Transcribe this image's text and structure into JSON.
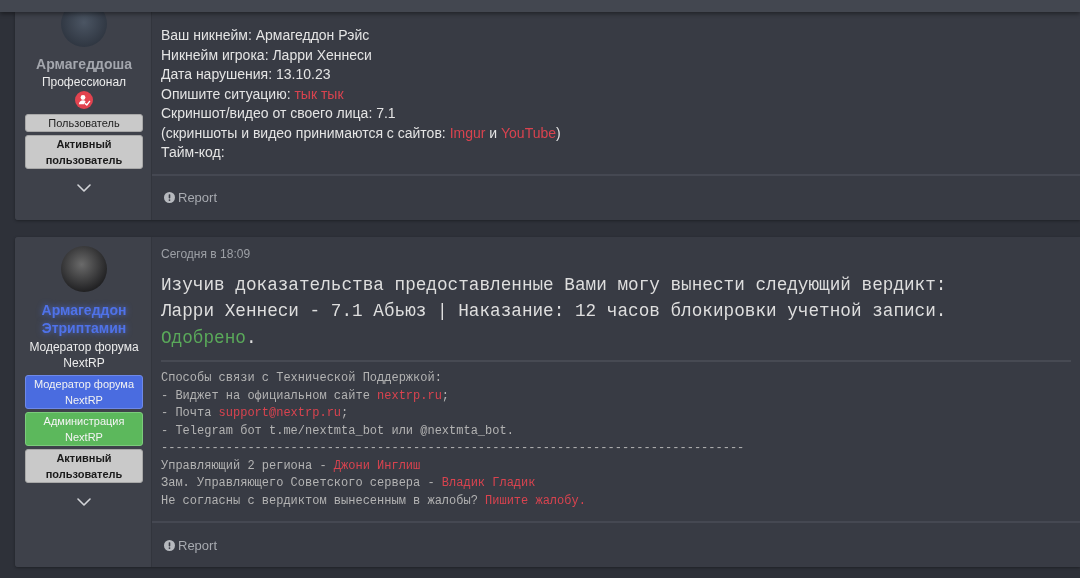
{
  "posts": [
    {
      "author": {
        "name": "Армагеддоша",
        "color": "#a3a6ad",
        "glow": false,
        "title": "Профессионал",
        "award_icon": true,
        "banners": [
          {
            "label": "Пользователь",
            "kind": "user"
          },
          {
            "label": "Активный пользователь",
            "kind": "active"
          }
        ]
      },
      "body": [
        {
          "kind": "form",
          "lines": [
            [
              {
                "text": "Ваш никнейм: Армагеддон Рэйс",
                "kind": "plain"
              }
            ],
            [
              {
                "text": "Никнейм игрока: Ларри Хеннеси",
                "kind": "plain"
              }
            ],
            [
              {
                "text": "Дата нарушения: 13.10.23",
                "kind": "plain"
              }
            ],
            [
              {
                "text": "Опишите ситуацию: ",
                "kind": "plain"
              },
              {
                "text": "тык тык",
                "kind": "link"
              }
            ],
            [
              {
                "text": "Скриншот/видео от своего лица: 7.1",
                "kind": "plain"
              }
            ],
            [
              {
                "text": "(скриншоты и видео принимаются с сайтов: ",
                "kind": "plain"
              },
              {
                "text": "Imgur",
                "kind": "link"
              },
              {
                "text": " и ",
                "kind": "plain"
              },
              {
                "text": "YouTube",
                "kind": "link"
              },
              {
                "text": ")",
                "kind": "plain"
              }
            ],
            [
              {
                "text": "Тайм-код:",
                "kind": "plain"
              }
            ]
          ]
        }
      ],
      "report": "Report"
    },
    {
      "author": {
        "name": "Армагеддон Этриптамин",
        "color": "#4f72e8",
        "glow": true,
        "title": "Модератор форума NextRP",
        "award_icon": false,
        "banners": [
          {
            "label": "Модератор форума NextRP",
            "kind": "moderator"
          },
          {
            "label": "Администрация NextRP",
            "kind": "admin"
          },
          {
            "label": "Активный пользователь",
            "kind": "active"
          }
        ]
      },
      "date": "Сегодня в 18:09",
      "body": [
        {
          "kind": "verdict",
          "lines": [
            [
              {
                "text": "Изучив доказательства предоставленные Вами могу вынести следующий вердикт:",
                "kind": "plain"
              }
            ],
            [
              {
                "text": "Ларри Хеннеси - 7.1 Абьюз | Наказание: 12 часов блокировки учетной записи.",
                "kind": "plain"
              }
            ],
            [
              {
                "text": "Одобрено",
                "kind": "success"
              },
              {
                "text": ".",
                "kind": "plain"
              }
            ]
          ]
        },
        {
          "kind": "signature",
          "lines": [
            [
              {
                "text": "Способы связи с Технической Поддержкой:",
                "kind": "plain"
              }
            ],
            [
              {
                "text": "- Виджет на официальном сайте ",
                "kind": "plain"
              },
              {
                "text": "nextrp.ru",
                "kind": "link"
              },
              {
                "text": ";",
                "kind": "plain"
              }
            ],
            [
              {
                "text": "- Почта ",
                "kind": "plain"
              },
              {
                "text": "support@nextrp.ru",
                "kind": "link"
              },
              {
                "text": ";",
                "kind": "plain"
              }
            ],
            [
              {
                "text": "- Telegram бот t.me/nextmta_bot или @nextmta_bot.",
                "kind": "plain"
              }
            ],
            [
              {
                "text": "---------------------------------------------------------------------------------",
                "kind": "plain"
              }
            ],
            [
              {
                "text": "Управляющий 2 региона - ",
                "kind": "plain"
              },
              {
                "text": "Джони Инглиш",
                "kind": "link"
              }
            ],
            [
              {
                "text": "Зам. Управляющего Советского сервера - ",
                "kind": "plain"
              },
              {
                "text": "Владик Гладик",
                "kind": "link"
              }
            ],
            [
              {
                "text": "Не согласны с вердиктом вынесенным в жалобы? ",
                "kind": "plain"
              },
              {
                "text": "Пишите жалобу.",
                "kind": "link"
              }
            ]
          ]
        }
      ],
      "report": "Report"
    }
  ]
}
